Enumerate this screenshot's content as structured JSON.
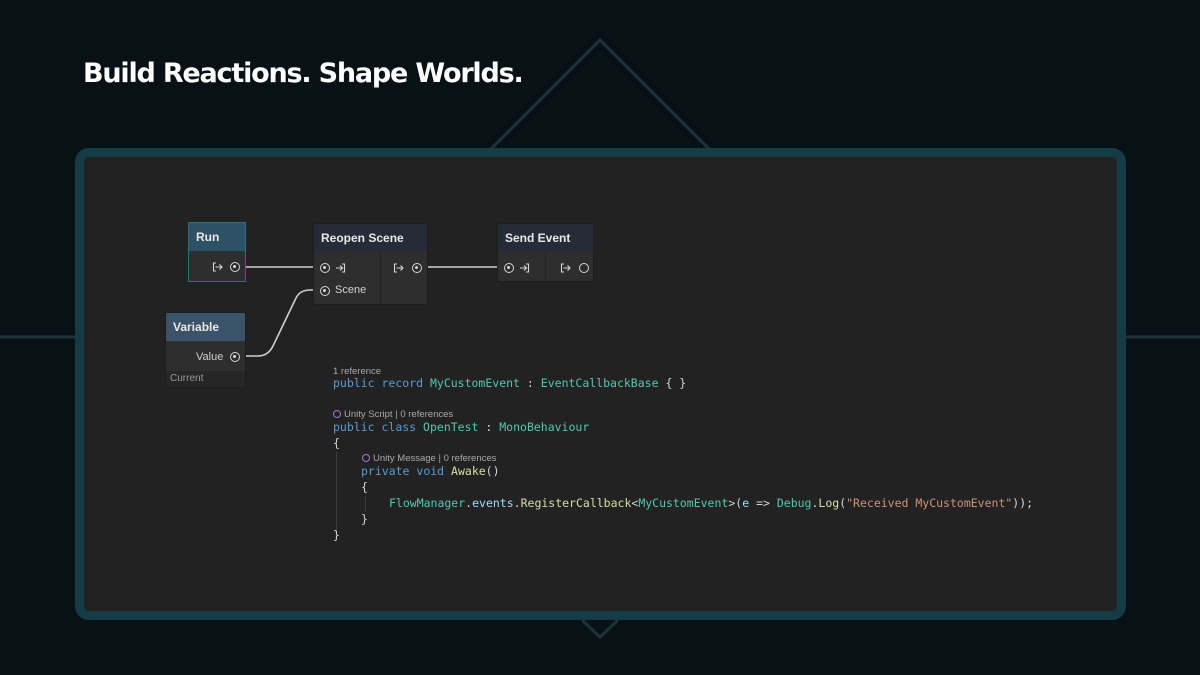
{
  "headline": "Build Reactions. Shape Worlds.",
  "graph": {
    "run_node": {
      "title": "Run"
    },
    "reopen_node": {
      "title": "Reopen Scene",
      "scene_label": "Scene"
    },
    "send_node": {
      "title": "Send Event"
    },
    "variable_node": {
      "title": "Variable",
      "value_label": "Value",
      "footer": "Current"
    }
  },
  "code": {
    "lens1": "1 reference",
    "line1": {
      "kw1": "public",
      "kw2": "record",
      "name": "MyCustomEvent",
      "colon": ":",
      "base": "EventCallbackBase",
      "braces": "{ }"
    },
    "lens2": {
      "a": "Unity Script",
      "sep": "|",
      "b": "0 references"
    },
    "line2": {
      "kw1": "public",
      "kw2": "class",
      "name": "OpenTest",
      "colon": ":",
      "base": "MonoBehaviour"
    },
    "open_brace": "{",
    "lens3": {
      "a": "Unity Message",
      "sep": "|",
      "b": "0 references"
    },
    "line3": {
      "kw1": "private",
      "kw2": "void",
      "name": "Awake",
      "parens": "()"
    },
    "inner_open": "{",
    "line4": {
      "obj": "FlowManager",
      "dot1": ".",
      "prop": "events",
      "dot2": ".",
      "method": "RegisterCallback",
      "lt": "<",
      "type": "MyCustomEvent",
      "gt": ">",
      "lparen": "(",
      "param": "e",
      "arrow": " => ",
      "cls": "Debug",
      "dot3": ".",
      "method2": "Log",
      "lparen2": "(",
      "str": "\"Received MyCustomEvent\"",
      "end": "));"
    },
    "inner_close": "}",
    "close_brace": "}"
  },
  "colors": {
    "background": "#081216",
    "frame_border": "#153c45",
    "panel": "#222222",
    "keyword": "#569cd6",
    "type": "#4ec9b0",
    "method": "#dcdcaa",
    "identifier": "#9cdcfe",
    "string": "#ce9178"
  },
  "icons": [
    "flow-exit-icon",
    "flow-enter-icon",
    "unity-icon"
  ]
}
